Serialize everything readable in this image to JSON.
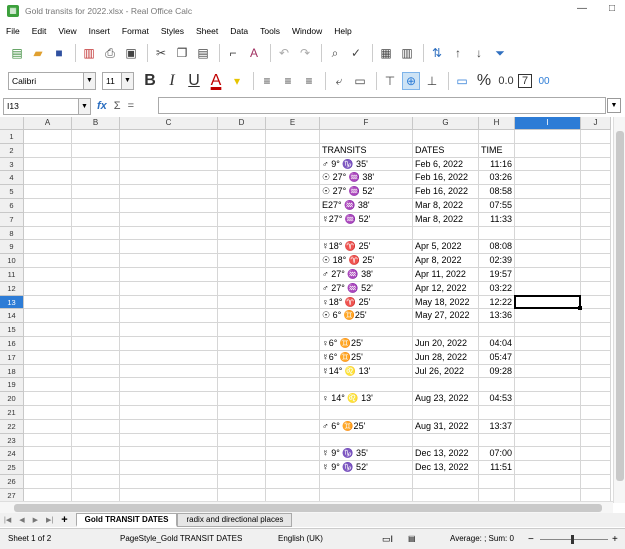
{
  "window": {
    "title": "Gold transits for 2022.xlsx - Real Office Calc",
    "minimize": "—",
    "maximize": "□"
  },
  "menu": [
    "File",
    "Edit",
    "View",
    "Insert",
    "Format",
    "Styles",
    "Sheet",
    "Data",
    "Tools",
    "Window",
    "Help"
  ],
  "toolbar": {
    "font_name": "Calibri",
    "font_size": "11",
    "bold": "B",
    "italic": "I",
    "underline": "U",
    "font_color": "A",
    "percent": "%",
    "decimal": "0.0",
    "seven": "7",
    "dec_more": "00"
  },
  "formula_bar": {
    "cell_ref": "I13",
    "fx": "fx",
    "sum": "Σ",
    "equals": "=",
    "content": ""
  },
  "columns": [
    "A",
    "B",
    "C",
    "D",
    "E",
    "F",
    "G",
    "H",
    "I",
    "J"
  ],
  "selected_column": "I",
  "selected_row": 13,
  "rows": [
    "1",
    "2",
    "3",
    "4",
    "5",
    "6",
    "7",
    "8",
    "9",
    "10",
    "11",
    "12",
    "13",
    "14",
    "15",
    "16",
    "17",
    "18",
    "19",
    "20",
    "21",
    "22",
    "23",
    "24",
    "25",
    "26",
    "27"
  ],
  "cells": [
    {
      "row": 2,
      "F": "TRANSITS",
      "G": "DATES",
      "H": "TIME"
    },
    {
      "row": 3,
      "F": "♂ 9° ♑ 35'",
      "G": "Feb 6, 2022",
      "H": "11:16"
    },
    {
      "row": 4,
      "F": "☉ 27° ♒ 38'",
      "G": "Feb 16, 2022",
      "H": "03:26"
    },
    {
      "row": 5,
      "F": "☉ 27° ♒ 52'",
      "G": "Feb 16, 2022",
      "H": "08:58"
    },
    {
      "row": 6,
      "F": "E27° ♒ 38'",
      "G": "Mar 8, 2022",
      "H": "07:55"
    },
    {
      "row": 7,
      "F": "☿27° ♒ 52'",
      "G": "Mar 8, 2022",
      "H": "11:33"
    },
    {
      "row": 9,
      "F": "☿18° ♈ 25'",
      "G": "Apr 5, 2022",
      "H": "08:08"
    },
    {
      "row": 10,
      "F": "☉ 18° ♈ 25'",
      "G": "Apr 8, 2022",
      "H": "02:39"
    },
    {
      "row": 11,
      "F": "♂ 27° ♒ 38'",
      "G": "Apr 11, 2022",
      "H": "19:57"
    },
    {
      "row": 12,
      "F": "♂ 27° ♒ 52'",
      "G": "Apr 12, 2022",
      "H": "03:22"
    },
    {
      "row": 13,
      "F": "♀18° ♈ 25'",
      "G": "May 18, 2022",
      "H": "12:22"
    },
    {
      "row": 14,
      "F": "☉ 6° ♊25'",
      "G": "May 27, 2022",
      "H": "13:36"
    },
    {
      "row": 16,
      "F": "♀6° ♊25'",
      "G": "Jun 20, 2022",
      "H": "04:04"
    },
    {
      "row": 17,
      "F": "☿6° ♊25'",
      "G": "Jun 28, 2022",
      "H": "05:47"
    },
    {
      "row": 18,
      "F": "☿14° ♌ 13'",
      "G": "Jul 26, 2022",
      "H": "09:28"
    },
    {
      "row": 20,
      "F": "♀ 14° ♌ 13'",
      "G": "Aug 23, 2022",
      "H": "04:53"
    },
    {
      "row": 22,
      "F": "♂ 6° ♊25'",
      "G": "Aug 31, 2022",
      "H": "13:37"
    },
    {
      "row": 24,
      "F": "☿ 9° ♑ 35'",
      "G": "Dec 13, 2022",
      "H": "07:00"
    },
    {
      "row": 25,
      "F": "☿ 9° ♑ 52'",
      "G": "Dec 13, 2022",
      "H": "11:51"
    }
  ],
  "sheets": {
    "active": "Gold TRANSIT DATES",
    "other": "radix and directional places",
    "add": "+"
  },
  "status": {
    "sheet": "Sheet 1 of 2",
    "page_style": "PageStyle_Gold TRANSIT DATES",
    "language": "English (UK)",
    "summary": "Average: ; Sum: 0"
  }
}
